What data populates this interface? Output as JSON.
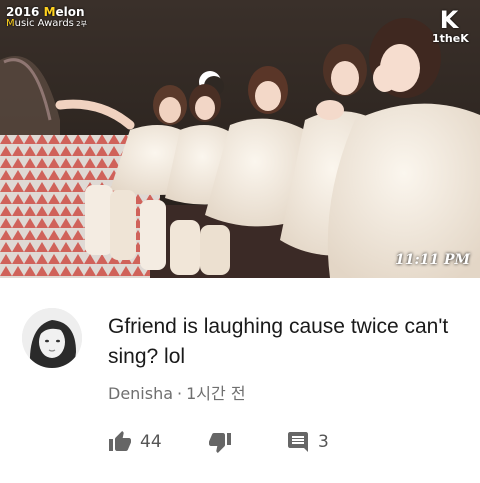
{
  "video": {
    "overlay": {
      "event_prefix": "2016 ",
      "event_brand_accent": "M",
      "event_brand_rest": "elon",
      "event_line2_accent": "M",
      "event_line2_rest": "usic Awards",
      "event_line2_suffix": " 2부"
    },
    "channel_logo_glyph": "K",
    "channel_logo_text": "1theK",
    "timestamp": "11:11 PM"
  },
  "comment": {
    "author": "Denisha",
    "separator": "·",
    "time": "1시간 전",
    "text": "Gfriend is laughing cause twice can't sing? lol",
    "like_count": "44",
    "reply_count": "3"
  },
  "icons": {
    "like": "thumbs-up-icon",
    "dislike": "thumbs-down-icon",
    "reply": "comment-icon"
  },
  "colors": {
    "meta_text": "#6f6f6f",
    "icon": "#666666",
    "logo_accent": "#ffd21f"
  }
}
